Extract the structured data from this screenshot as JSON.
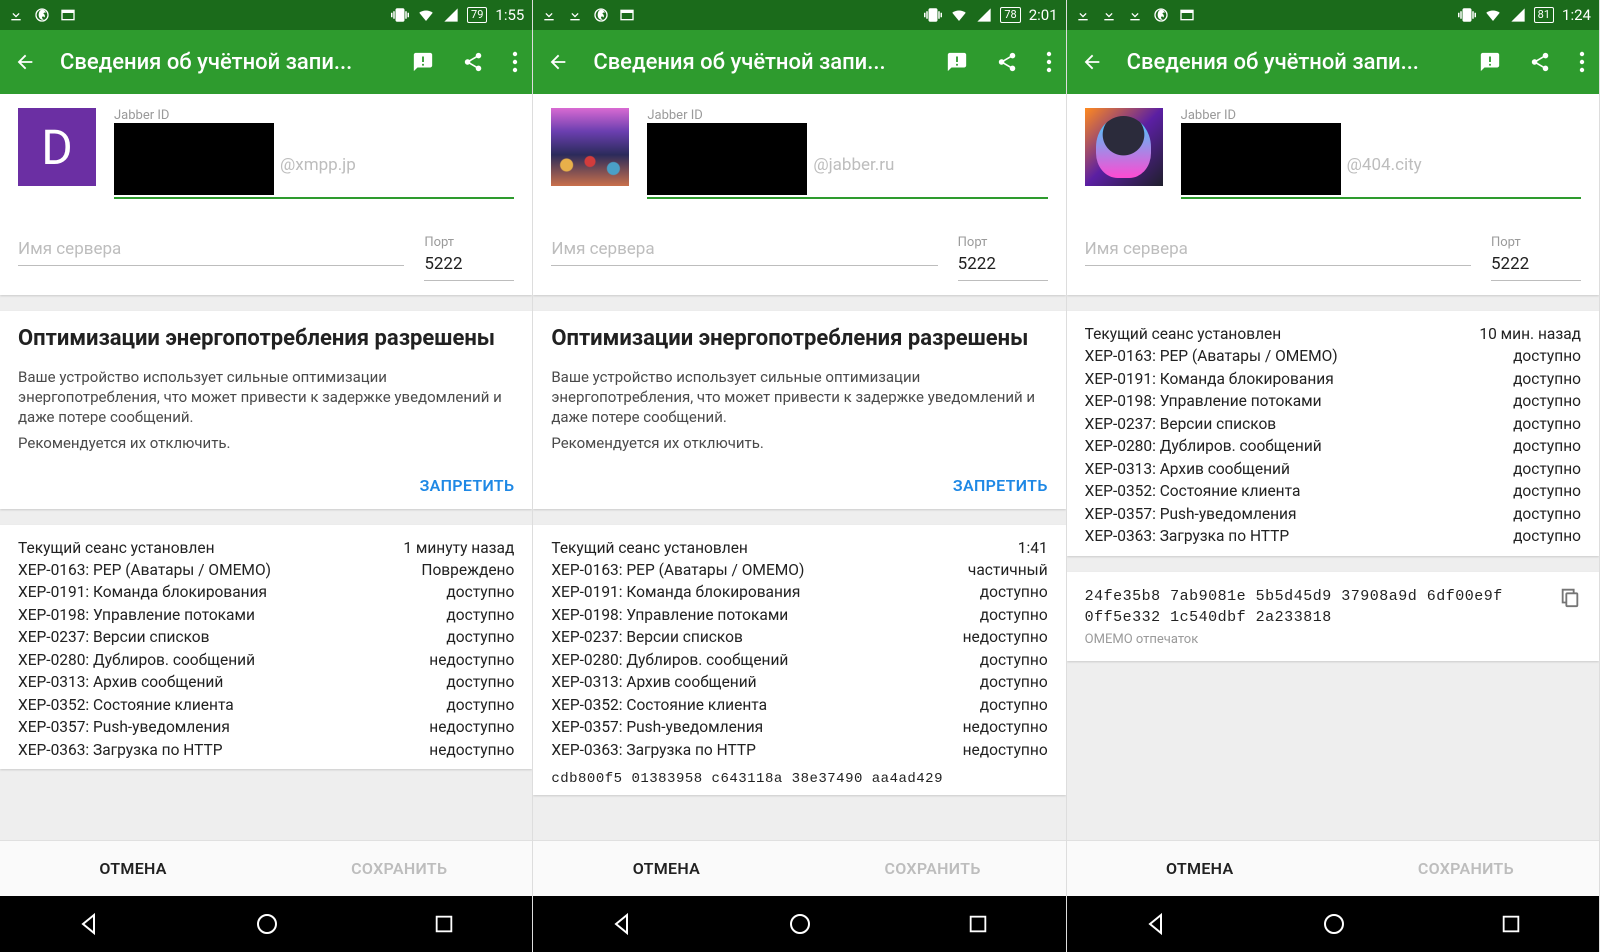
{
  "common": {
    "actionbar_title": "Сведения об учётной запи...",
    "jabber_id_label": "Jabber ID",
    "server_label": "Имя сервера",
    "port_label": "Порт",
    "port_value": "5222",
    "opt_title": "Оптимизации энергопотребления разрешены",
    "opt_body1": "Ваше устройство использует сильные оптимизации энергопотребления, что может привести к задержке уведомлений и даже потере сообщений.",
    "opt_body2": "Рекомендуется их отключить.",
    "opt_action": "ЗАПРЕТИТЬ",
    "cancel": "ОТМЕНА",
    "save": "СОХРАНИТЬ",
    "session_label": "Текущий сеанс установлен",
    "xep": {
      "163": "XEP-0163: PEP (Аватары / OMEMO)",
      "191": "XEP-0191: Команда блокирования",
      "198": "XEP-0198: Управление потоками",
      "237": "XEP-0237: Версии списков",
      "280": "XEP-0280: Дублиров. сообщений",
      "313": "XEP-0313: Архив сообщений",
      "352": "XEP-0352: Состояние клиента",
      "357": "XEP-0357: Push-уведомления",
      "363": "XEP-0363: Загрузка по HTTP"
    },
    "status": {
      "avail": "доступно",
      "unavail": "недоступно",
      "broken": "Повреждено",
      "partial": "частичный"
    },
    "omemo_label": "OMEMO отпечаток"
  },
  "p1": {
    "batt": "79",
    "time": "1:55",
    "avatar_letter": "D",
    "domain": "@xmpp.jp",
    "session_time": "1 минуту назад",
    "xep163": "Повреждено",
    "xep191": "доступно",
    "xep198": "доступно",
    "xep237": "доступно",
    "xep280": "недоступно",
    "xep313": "доступно",
    "xep352": "доступно",
    "xep357": "недоступно",
    "xep363": "недоступно"
  },
  "p2": {
    "batt": "78",
    "time": "2:01",
    "domain": "@jabber.ru",
    "session_time": "1:41",
    "xep163": "частичный",
    "xep191": "доступно",
    "xep198": "доступно",
    "xep237": "недоступно",
    "xep280": "доступно",
    "xep313": "доступно",
    "xep352": "доступно",
    "xep357": "недоступно",
    "xep363": "недоступно",
    "fp_partial": "cdb800f5  01383958  c643118a  38e37490  aa4ad429"
  },
  "p3": {
    "batt": "81",
    "time": "1:24",
    "domain": "@404.city",
    "session_time": "10 мин. назад",
    "xep163": "доступно",
    "xep191": "доступно",
    "xep198": "доступно",
    "xep237": "доступно",
    "xep280": "доступно",
    "xep313": "доступно",
    "xep352": "доступно",
    "xep357": "доступно",
    "xep363": "доступно",
    "fp_line1": "24fe35b8  7ab9081e  5b5d45d9  37908a9d  6df00e9f",
    "fp_line2": "0ff5e332  1c540dbf  2a233818"
  }
}
